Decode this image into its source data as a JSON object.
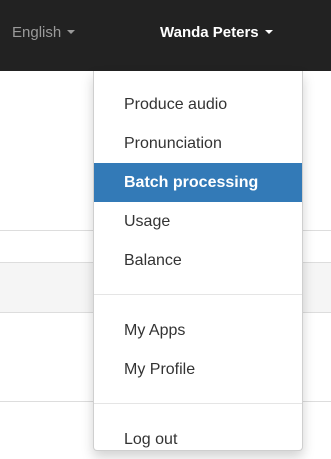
{
  "navbar": {
    "language_label": "English",
    "user_label": "Wanda Peters"
  },
  "menu": {
    "group1": [
      "Produce audio",
      "Pronunciation",
      "Batch processing",
      "Usage",
      "Balance"
    ],
    "group2": [
      "My Apps",
      "My Profile"
    ],
    "group3": [
      "Log out"
    ],
    "active_item": "Batch processing"
  },
  "colors": {
    "navbar_bg": "#222222",
    "user_tab_bg": "#080808",
    "active_bg": "#337ab7",
    "active_text": "#ffffff",
    "menu_text": "#333333",
    "language_text": "#9a9a9a"
  },
  "icons": {
    "language_caret": "caret-down-icon",
    "user_caret": "caret-down-icon"
  }
}
